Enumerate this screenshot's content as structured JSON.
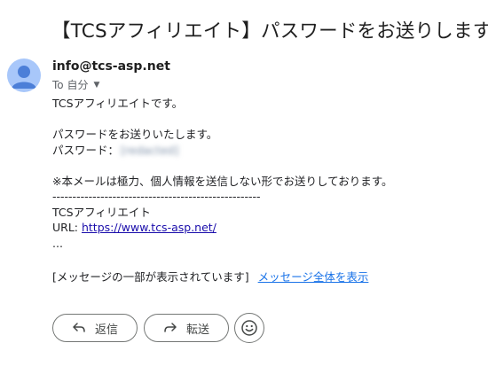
{
  "subject": "【TCSアフィリエイト】パスワードをお送りします。",
  "sender": {
    "email": "info@tcs-asp.net",
    "recipient_label": "To 自分",
    "avatar_icon": "person-icon",
    "avatar_color": "#a8c7fa"
  },
  "body": {
    "line1": "TCSアフィリエイトです。",
    "line2": "パスワードをお送りいたします。",
    "password_label": "パスワード：",
    "password_value": "[redacted]",
    "notice": "※本メールは極力、個人情報を送信しない形でお送りしております。",
    "divider": "----------------------------------------------------",
    "signature_name": "TCSアフィリエイト",
    "url_label": "URL: ",
    "url": "https://www.tcs-asp.net/",
    "ellipsis": "..."
  },
  "truncation": {
    "message": "[メッセージの一部が表示されています]",
    "link": "メッセージ全体を表示"
  },
  "actions": {
    "reply_label": "返信",
    "forward_label": "転送",
    "reply_icon": "reply-icon",
    "forward_icon": "forward-icon",
    "emoji_icon": "emoji-icon"
  }
}
